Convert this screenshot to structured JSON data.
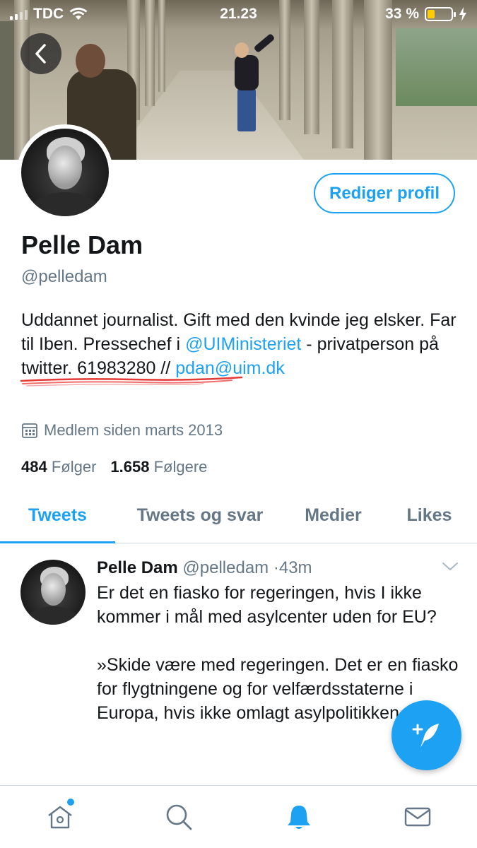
{
  "status_bar": {
    "carrier": "TDC",
    "time": "21.23",
    "battery": "33 %"
  },
  "profile": {
    "edit_button": "Rediger profil",
    "name": "Pelle Dam",
    "handle": "@pelledam",
    "bio_part1": "Uddannet journalist. Gift med den kvinde jeg elsker. Far til Iben. Pressechef i ",
    "bio_mention": "@UIMinisteriet",
    "bio_part2": " - privatperson på twitter. 61983280 // ",
    "bio_email": "pdan@uim.dk",
    "joined": "Medlem siden marts 2013",
    "following_count": "484",
    "following_label": "Følger",
    "followers_count": "1.658",
    "followers_label": "Følgere"
  },
  "tabs": [
    {
      "label": "Tweets",
      "active": true
    },
    {
      "label": "Tweets og svar",
      "active": false
    },
    {
      "label": "Medier",
      "active": false
    },
    {
      "label": "Likes",
      "active": false
    }
  ],
  "tweet": {
    "name": "Pelle Dam",
    "handle": "@pelledam",
    "separator": "·",
    "time": "43m",
    "text": "Er det en fiasko for regeringen, hvis I ikke kommer i mål med asylcenter uden for EU?\n\n»Skide være med regeringen. Det er en fiasko for flygtningene og for velfærdsstaterne i Europa, hvis ikke omlagt asylpolitikken«"
  },
  "bottom_nav": {
    "items": [
      "home-icon",
      "search-icon",
      "notifications-icon",
      "messages-icon"
    ],
    "active": "notifications-icon"
  },
  "colors": {
    "accent": "#1da1f2",
    "text": "#14171a",
    "secondary": "#657786",
    "annotation": "#e53935"
  }
}
